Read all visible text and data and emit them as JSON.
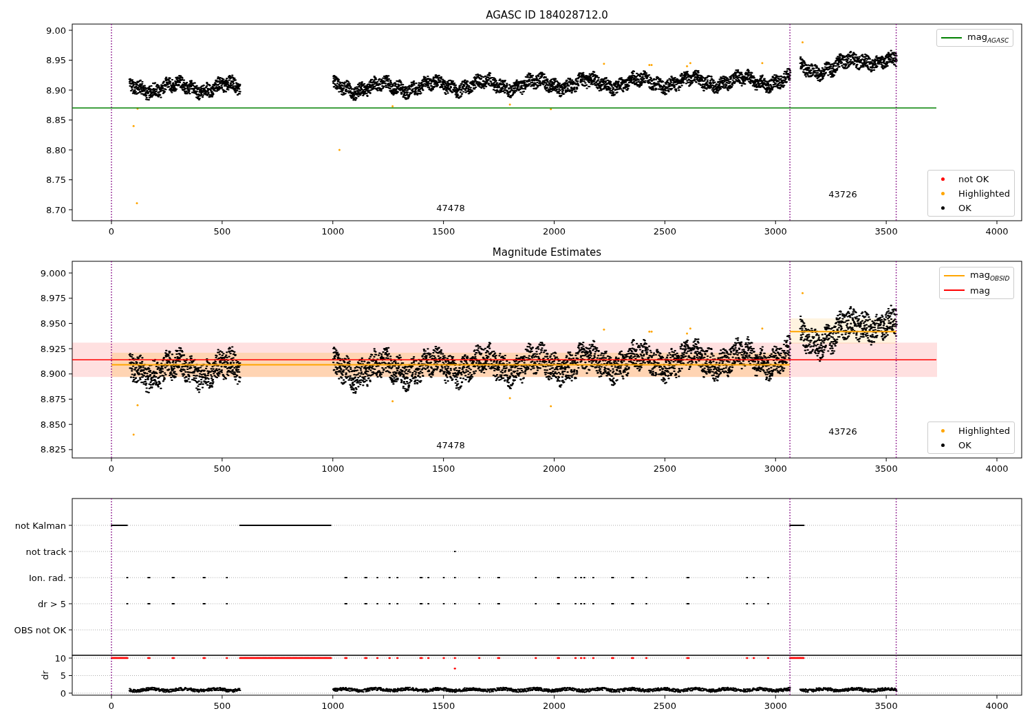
{
  "panels": [
    {
      "title": "AGASC ID 184028712.0",
      "yticks": [
        "9.00",
        "8.95",
        "8.90",
        "8.85",
        "8.80",
        "8.75",
        "8.70"
      ],
      "xticks": [
        "0",
        "500",
        "1000",
        "1500",
        "2000",
        "2500",
        "3000",
        "3500",
        "4000"
      ],
      "legends": [
        [
          {
            "label": "mag$_{AGASC}$",
            "kind": "line",
            "color": "#008000"
          }
        ],
        [
          {
            "label": "not OK",
            "kind": "dot",
            "color": "#ff0000"
          },
          {
            "label": "Highlighted",
            "kind": "dot",
            "color": "#ffa500"
          },
          {
            "label": "OK",
            "kind": "dot",
            "color": "#000000"
          }
        ]
      ],
      "annotations": [
        "47478",
        "43726"
      ]
    },
    {
      "title": "Magnitude Estimates",
      "yticks": [
        "9.000",
        "8.975",
        "8.950",
        "8.925",
        "8.900",
        "8.875",
        "8.850",
        "8.825"
      ],
      "xticks": [
        "0",
        "500",
        "1000",
        "1500",
        "2000",
        "2500",
        "3000",
        "3500",
        "4000"
      ],
      "legends": [
        [
          {
            "label": "mag$_{OBSID}$",
            "kind": "line",
            "color": "#ffa500"
          },
          {
            "label": "mag",
            "kind": "line",
            "color": "#ff0000"
          }
        ],
        [
          {
            "label": "Highlighted",
            "kind": "dot",
            "color": "#ffa500"
          },
          {
            "label": "OK",
            "kind": "dot",
            "color": "#000000"
          }
        ]
      ],
      "annotations": [
        "47478",
        "43726"
      ]
    }
  ],
  "flags": {
    "categories": [
      "not Kalman",
      "not track",
      "Ion. rad.",
      "dr > 5",
      "OBS not OK"
    ]
  },
  "dr": {
    "ylabel": "dr",
    "yticks": [
      "10",
      "5",
      "0"
    ],
    "xticks": [
      "0",
      "500",
      "1000",
      "1500",
      "2000",
      "2500",
      "3000",
      "3500",
      "4000"
    ]
  }
}
